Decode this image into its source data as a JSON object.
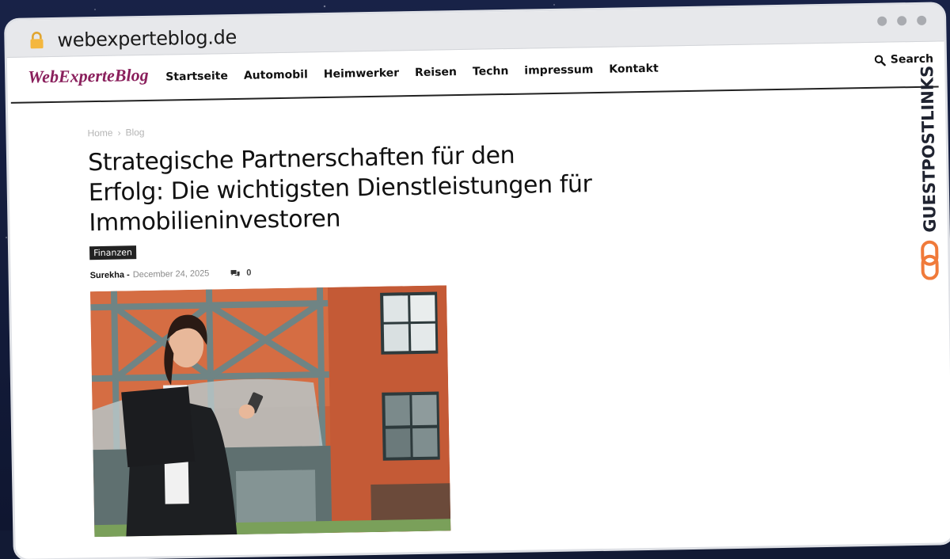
{
  "browser": {
    "url": "webexperteblog.de"
  },
  "site": {
    "logo": "WebExperteBlog",
    "menu": [
      "Startseite",
      "Automobil",
      "Heimwerker",
      "Reisen",
      "Techn",
      "impressum",
      "Kontakt"
    ],
    "search_label": "Search"
  },
  "breadcrumb": {
    "home": "Home",
    "separator": "›",
    "current": "Blog"
  },
  "article": {
    "title": "Strategische Partnerschaften für den Erfolg: Die wichtigsten Dienstleistungen für Immobilieninvestoren",
    "category": "Finanzen",
    "author": "Surekha -",
    "date": "December 24, 2025",
    "comments_count": "0"
  },
  "brand_watermark": "GUESTPOSTLINKS",
  "colors": {
    "logo": "#8a1f5c",
    "accent_orange": "#f07a3a",
    "brick": "#c8613a"
  }
}
